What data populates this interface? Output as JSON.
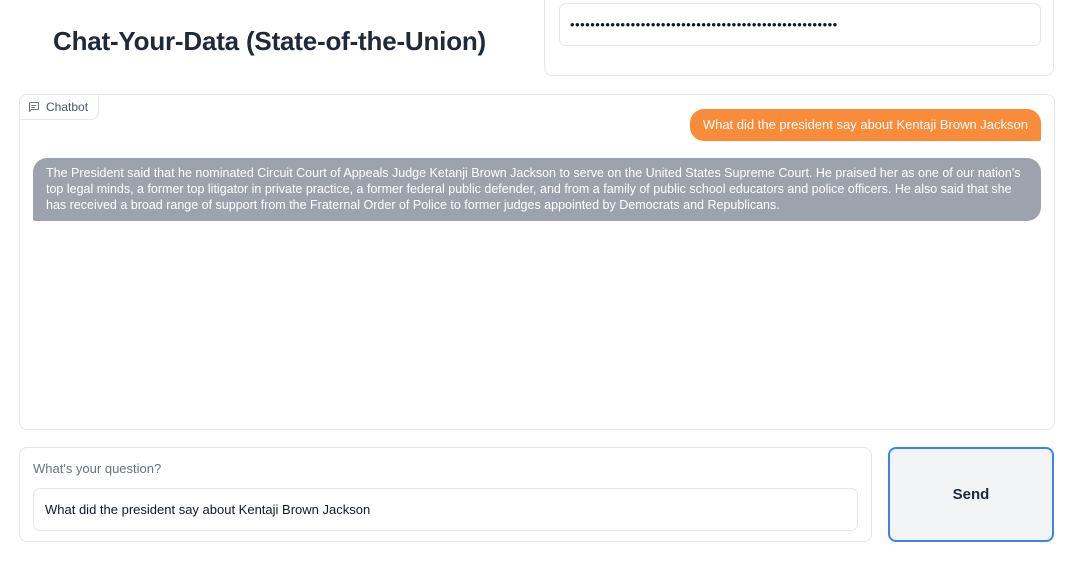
{
  "app": {
    "title": "Chat-Your-Data (State-of-the-Union)"
  },
  "api_key": {
    "masked_value": "•••••••••••••••••••••••••••••••••••••••••••••••••••••"
  },
  "chatbot": {
    "label": "Chatbot",
    "icon": "chat-bubble-icon",
    "messages": [
      {
        "role": "user",
        "text": "What did the president say about Kentaji Brown Jackson"
      },
      {
        "role": "bot",
        "text": "The President said that he nominated Circuit Court of Appeals Judge Ketanji Brown Jackson to serve on the United States Supreme Court. He praised her as one of our nation's top legal minds, a former top litigator in private practice, a former federal public defender, and from a family of public school educators and police officers. He also said that she has received a broad range of support from the Fraternal Order of Police to former judges appointed by Democrats and Republicans."
      }
    ],
    "colors": {
      "user_bubble": "#f98c3a",
      "bot_bubble": "#9ca3af"
    }
  },
  "question": {
    "label": "What's your question?",
    "value": "What did the president say about Kentaji Brown Jackson"
  },
  "send": {
    "label": "Send",
    "accent": "#3b82f6"
  }
}
